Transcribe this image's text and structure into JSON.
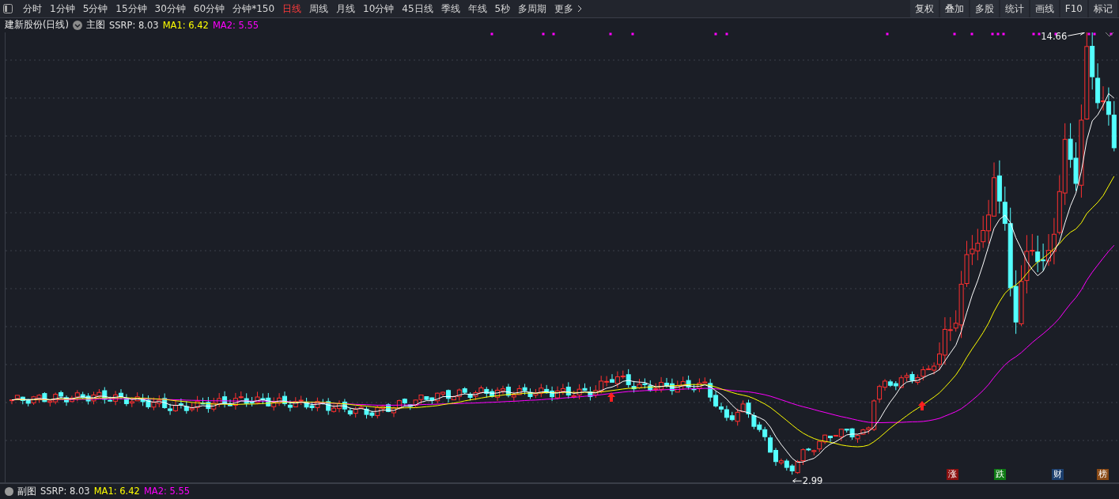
{
  "toolbar": {
    "periods": [
      {
        "label": "分时",
        "selected": false
      },
      {
        "label": "1分钟",
        "selected": false
      },
      {
        "label": "5分钟",
        "selected": false
      },
      {
        "label": "15分钟",
        "selected": false
      },
      {
        "label": "30分钟",
        "selected": false
      },
      {
        "label": "60分钟",
        "selected": false
      },
      {
        "label": "分钟*150",
        "selected": false
      },
      {
        "label": "日线",
        "selected": true
      },
      {
        "label": "周线",
        "selected": false
      },
      {
        "label": "月线",
        "selected": false
      },
      {
        "label": "10分钟",
        "selected": false
      },
      {
        "label": "45日线",
        "selected": false
      },
      {
        "label": "季线",
        "selected": false
      },
      {
        "label": "年线",
        "selected": false
      },
      {
        "label": "5秒",
        "selected": false
      },
      {
        "label": "多周期",
        "selected": false
      }
    ],
    "more": "更多",
    "tools": [
      "复权",
      "叠加",
      "多股",
      "统计",
      "画线",
      "F10",
      "标记"
    ]
  },
  "chart_header": {
    "title": "建新股份(日线)",
    "main_label": "主图",
    "indicators": [
      {
        "text": "SSRP: 8.03",
        "color": "#e0e0e0"
      },
      {
        "text": "MA1: 6.42",
        "color": "#ffff00"
      },
      {
        "text": "MA2: 5.55",
        "color": "#ff00ff"
      }
    ]
  },
  "price_chart": {
    "high_label": "14.66",
    "low_label": "2.99",
    "event_badges": [
      {
        "label": "涨",
        "color": "#8b1010"
      },
      {
        "label": "跌",
        "color": "#0e7a14"
      },
      {
        "label": "财",
        "color": "#1c3f6e"
      },
      {
        "label": "榜",
        "color": "#8a4a16"
      }
    ]
  },
  "sub_chart_header": {
    "title": "副图",
    "indicators": [
      {
        "text": "SSRP: 8.03",
        "color": "#e0e0e0"
      },
      {
        "text": "MA1: 6.42",
        "color": "#ffff00"
      },
      {
        "text": "MA2: 5.55",
        "color": "#ff00ff"
      }
    ]
  }
}
